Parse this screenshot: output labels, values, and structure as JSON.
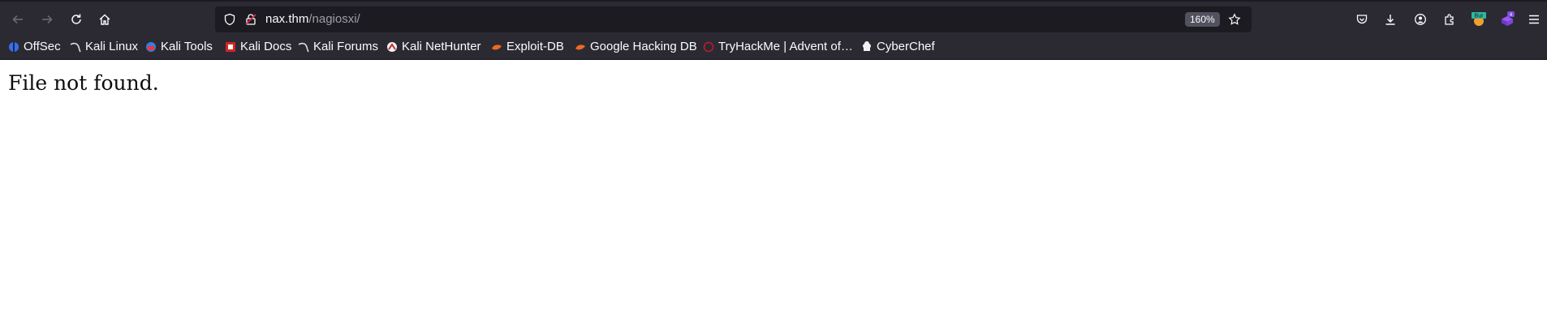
{
  "urlbar": {
    "host": "nax.thm",
    "path": "/nagiosxi/",
    "zoom": "160%"
  },
  "extensions": {
    "burp_label": "Bur",
    "badge_count": "4"
  },
  "bookmarks": [
    {
      "label": "OffSec",
      "icon": "offsec-icon"
    },
    {
      "label": "Kali Linux",
      "icon": "kali-dragon-icon"
    },
    {
      "label": "Kali Tools",
      "icon": "kali-tools-icon"
    },
    {
      "label": "Kali Docs",
      "icon": "kali-docs-icon"
    },
    {
      "label": "Kali Forums",
      "icon": "kali-dragon-icon"
    },
    {
      "label": "Kali NetHunter",
      "icon": "nethunter-icon"
    },
    {
      "label": "Exploit-DB",
      "icon": "exploit-db-icon"
    },
    {
      "label": "Google Hacking DB",
      "icon": "exploit-db-icon"
    },
    {
      "label": "TryHackMe | Advent of…",
      "icon": "tryhackme-icon"
    },
    {
      "label": "CyberChef",
      "icon": "cyberchef-icon"
    }
  ],
  "page": {
    "message": "File not found."
  }
}
